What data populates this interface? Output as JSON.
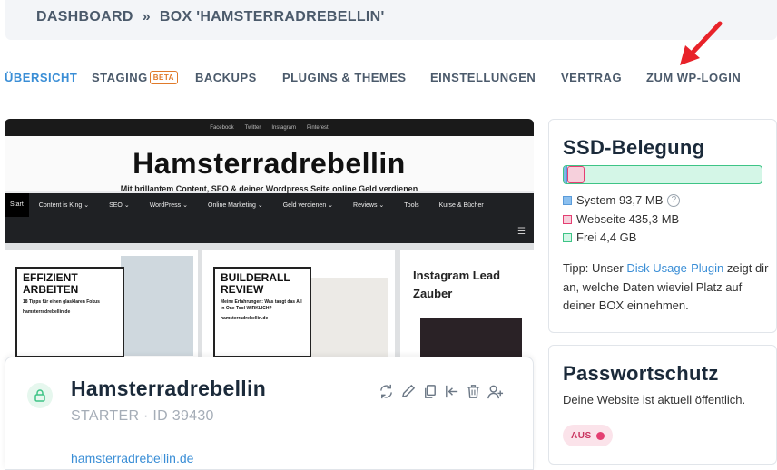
{
  "breadcrumb": {
    "dashboard": "DASHBOARD",
    "separator": "»",
    "current": "BOX 'HAMSTERRADREBELLIN'"
  },
  "tabs": [
    {
      "label": "ÜBERSICHT",
      "active": true
    },
    {
      "label": "STAGING",
      "badge": "BETA"
    },
    {
      "label": "BACKUPS"
    },
    {
      "label": "PLUGINS & THEMES"
    },
    {
      "label": "EINSTELLUNGEN"
    },
    {
      "label": "VERTRAG"
    },
    {
      "label": "ZUM WP-LOGIN"
    }
  ],
  "preview": {
    "top_links": [
      "Facebook",
      "Twitter",
      "Instagram",
      "Pinterest"
    ],
    "title": "Hamsterradrebellin",
    "subtitle": "Mit brillantem Content, SEO & deiner Wordpress Seite online Geld verdienen",
    "nav": [
      "Start",
      "Content is King ⌄",
      "SEO ⌄",
      "WordPress ⌄",
      "Online Marketing ⌄",
      "Geld verdienen ⌄",
      "Reviews ⌄",
      "Tools",
      "Kurse & Bücher"
    ],
    "card1": {
      "title_line1": "EFFIZIENT",
      "title_line2": "ARBEITEN",
      "small": "18 Tipps für einen glasklaren Fokus",
      "footer": "hamsterradrebellin.de"
    },
    "card2": {
      "title_line1": "BUILDERALL",
      "title_line2": "REVIEW",
      "small": "Meine Erfahrungen: Was taugt das All in One Tool WIRKLICH?",
      "footer": "hamsterradrebellin.de"
    },
    "side_title_line1": "Instagram Lead",
    "side_title_line2": "Zauber"
  },
  "site": {
    "name": "Hamsterradrebellin",
    "plan": "STARTER · ID 39430",
    "link": "hamsterradrebellin.de",
    "actions": [
      "refresh-icon",
      "edit-icon",
      "copy-icon",
      "migrate-icon",
      "trash-icon",
      "add-user-icon"
    ]
  },
  "ssd": {
    "title": "SSD-Belegung",
    "usage": {
      "system_mb": 93.7,
      "website_mb": 435.3,
      "free_gb": 4.4
    },
    "legend": {
      "system": "System 93,7 MB",
      "website": "Webseite 435,3 MB",
      "free": "Frei 4,4 GB"
    },
    "help": "?",
    "tip_prefix": "Tipp: Unser ",
    "tip_link": "Disk Usage-Plugin",
    "tip_suffix": " zeigt dir an, welche Daten wieviel Platz auf deiner BOX einnehmen."
  },
  "password": {
    "title": "Passwortschutz",
    "text": "Deine Website ist aktuell öffentlich.",
    "badge": "AUS"
  },
  "colors": {
    "accent": "#3a8ed6",
    "system": "#7fb5ea",
    "website": "#e43f72",
    "free": "#3ec486",
    "arrow": "#e8232a"
  }
}
